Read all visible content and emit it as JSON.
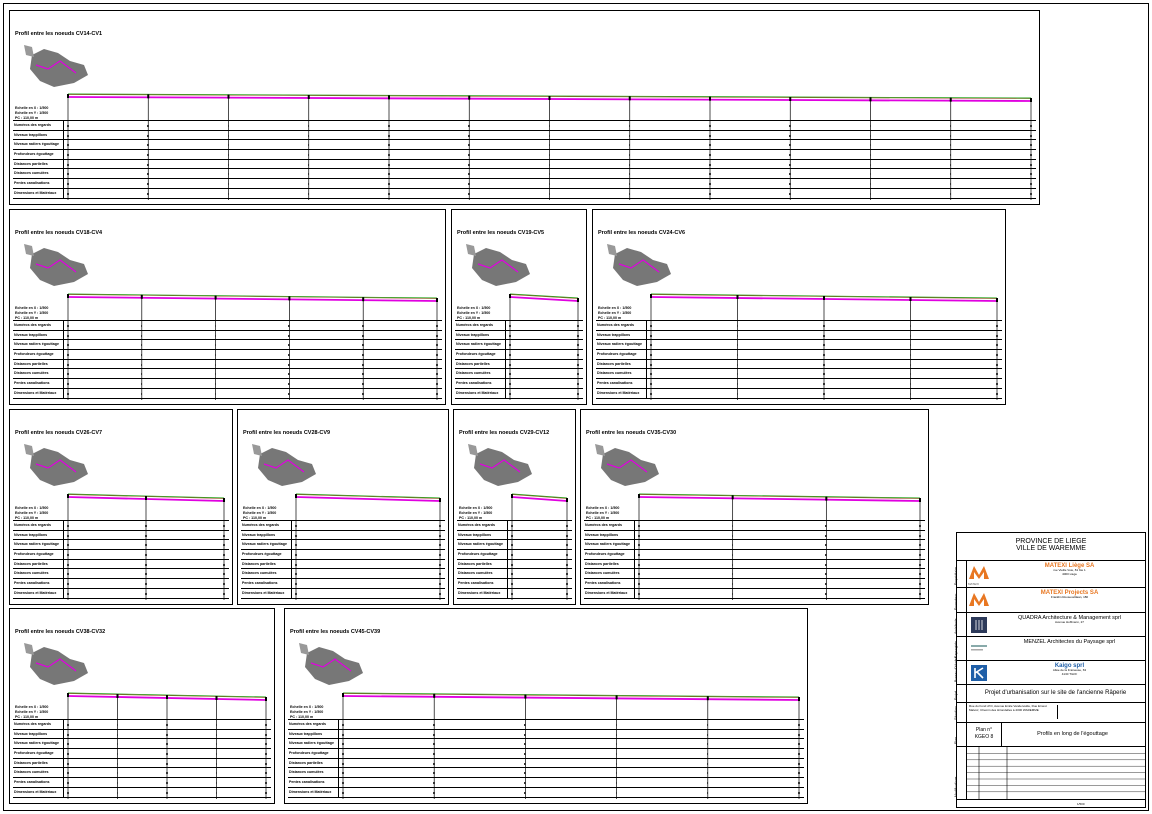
{
  "colors": {
    "profile_magenta": "#e000e0",
    "terrain_green": "#22a61a",
    "terrain_brown": "#a0522d",
    "map_gray": "#777777",
    "accent_orange": "#e87722"
  },
  "row_labels": [
    "Numéros des regards",
    "Niveaux trappillons",
    "Niveaux radiers égouttage",
    "Profondeurs égouttage",
    "Distances partielles",
    "Distances cumulées",
    "Pentes canalisations",
    "Dimensions et Matériaux"
  ],
  "panels": [
    {
      "title": "Profil entre les noeuds  CV14-CV1",
      "scale": "Echelle en X : 1/500\nEchelle en Y : 1/500\nPC : 110,00 m"
    },
    {
      "title": "Profil entre les noeuds  CV18-CV4",
      "scale": "Echelle en X : 1/500\nEchelle en Y : 1/500\nPC : 110,00 m"
    },
    {
      "title": "Profil entre les noeuds  CV19-CV5",
      "scale": "Echelle en X : 1/500\nEchelle en Y : 1/500\nPC : 110,00 m"
    },
    {
      "title": "Profil entre les noeuds  CV24-CV6",
      "scale": "Echelle en X : 1/500\nEchelle en Y : 1/500\nPC : 110,00 m"
    },
    {
      "title": "Profil entre les noeuds  CV26-CV7",
      "scale": "Echelle en X : 1/500\nEchelle en Y : 1/500\nPC : 110,00 m"
    },
    {
      "title": "Profil entre les noeuds  CV28-CV9",
      "scale": "Echelle en X : 1/500\nEchelle en Y : 1/500\nPC : 110,00 m"
    },
    {
      "title": "Profil entre les noeuds  CV29-CV12",
      "scale": "Echelle en X : 1/500\nEchelle en Y : 1/500\nPC : 110,00 m"
    },
    {
      "title": "Profil entre les noeuds  CV35-CV30",
      "scale": "Echelle en X : 1/500\nEchelle en Y : 1/500\nPC : 110,00 m"
    },
    {
      "title": "Profil entre les noeuds  CV38-CV32",
      "scale": "Echelle en X : 1/500\nEchelle en Y : 1/500\nPC : 110,00 m"
    },
    {
      "title": "Profil entre les noeuds  CV45-CV39",
      "scale": "Echelle en X : 1/500\nEchelle en Y : 1/500\nPC : 110,00 m"
    }
  ],
  "titleblock": {
    "province": "PROVINCE DE LIEGE",
    "ville": "VILLE DE WAREMME",
    "side_proprietaire": "Propriétaire",
    "side_promoteur": "Promoteur",
    "side_architecte": "Architecte",
    "side_paysagiste": "Paysagiste",
    "side_bureau": "Bureau d'études",
    "side_projet": "Projet",
    "side_situation": "Situation",
    "side_plan": "Plan",
    "side_modifications": "Modifications",
    "matexi_liege": "MATEXI Liège SA",
    "matexi_liege_addr": "rue Vieille Voie, 81 bte 1",
    "matexi_liege_city": "4000 Liège",
    "matexi_projects": "MATEXI Projects SA",
    "matexi_projects_addr": "Franklin Rooseveltlaan, 180",
    "matexi_logo": "MATEXI",
    "quadra": "QUADRA Architecture & Management sprl",
    "quadra_addr": "Avenue Hoffmann, 27",
    "menzel": "MENZEL Architectes du Paysage sprl",
    "kaigo": "Kaigo sprl",
    "kaigo_addr": "Allée de la Fraineuse, 63",
    "kaigo_city": "4130 TILFF",
    "projet": "Projet d'urbanisation sur le site de l'ancienne Râperie",
    "situation": "Rue du Fond d'Or, Avenue Emile Vandervelde, Rue Ernest Malvoz, Chemin des Hirondelles à 4300 WAREMME",
    "plan_label": "Plan n°",
    "plan_no": "KGEO 8",
    "plan_title": "Profils en long de l'égouttage",
    "footer_scale": "1/500",
    "footer_sheet": "Ech.: 1/500"
  }
}
